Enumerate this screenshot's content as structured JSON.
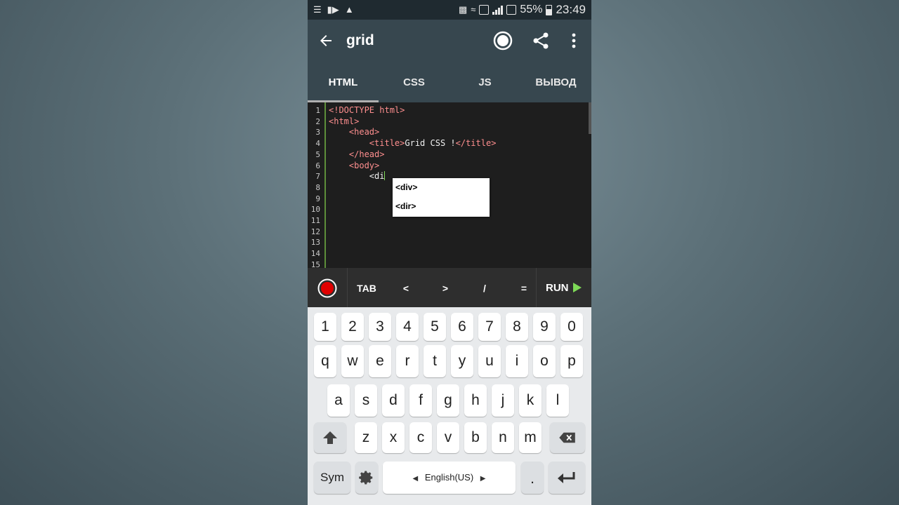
{
  "status": {
    "battery": "55%",
    "time": "23:49"
  },
  "appbar": {
    "title": "grid"
  },
  "tabs": [
    {
      "label": "HTML",
      "active": true
    },
    {
      "label": "CSS",
      "active": false
    },
    {
      "label": "JS",
      "active": false
    },
    {
      "label": "ВЫВОД",
      "active": false
    }
  ],
  "editor": {
    "line_numbers": [
      "1",
      "2",
      "3",
      "4",
      "5",
      "6",
      "7",
      "8",
      "9",
      "10",
      "11",
      "12",
      "13",
      "14",
      "15"
    ],
    "lines": [
      {
        "indent": "",
        "parts": [
          {
            "t": "tag",
            "s": "<!DOCTYPE html>"
          }
        ]
      },
      {
        "indent": "",
        "parts": [
          {
            "t": "tag",
            "s": "<html>"
          }
        ]
      },
      {
        "indent": "    ",
        "parts": [
          {
            "t": "tag",
            "s": "<head>"
          }
        ]
      },
      {
        "indent": "        ",
        "parts": [
          {
            "t": "tag",
            "s": "<title>"
          },
          {
            "t": "txt",
            "s": "Grid CSS !"
          },
          {
            "t": "tag",
            "s": "</title>"
          }
        ]
      },
      {
        "indent": "    ",
        "parts": [
          {
            "t": "tag",
            "s": "</head>"
          }
        ]
      },
      {
        "indent": "    ",
        "parts": [
          {
            "t": "tag",
            "s": "<body>"
          }
        ]
      },
      {
        "indent": "        ",
        "parts": [
          {
            "t": "txt",
            "s": "<di"
          }
        ],
        "cursor": true
      }
    ],
    "autocomplete": [
      "<div>",
      "<dir>"
    ]
  },
  "toolbar": {
    "keys": [
      "TAB",
      "<",
      ">",
      "/",
      "="
    ],
    "run_label": "RUN"
  },
  "keyboard": {
    "row_numbers": [
      "1",
      "2",
      "3",
      "4",
      "5",
      "6",
      "7",
      "8",
      "9",
      "0"
    ],
    "row_q": [
      "q",
      "w",
      "e",
      "r",
      "t",
      "y",
      "u",
      "i",
      "o",
      "p"
    ],
    "row_a": [
      "a",
      "s",
      "d",
      "f",
      "g",
      "h",
      "j",
      "k",
      "l"
    ],
    "row_z": [
      "z",
      "x",
      "c",
      "v",
      "b",
      "n",
      "m"
    ],
    "sym_label": "Sym",
    "language_label": "English(US)",
    "period_label": "."
  },
  "colors": {
    "appbar": "#37474f",
    "tag": "#ff8f8f",
    "accent_green": "#7ed957",
    "record_red": "#e00000"
  }
}
